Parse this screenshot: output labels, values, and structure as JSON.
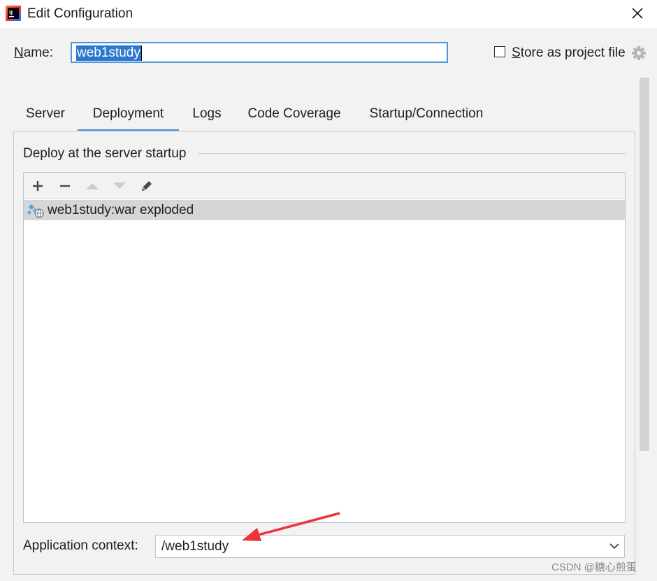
{
  "window": {
    "title": "Edit Configuration",
    "close_icon": "close-icon",
    "app_icon": "intellij-idea-icon"
  },
  "name_field": {
    "label_mnemonic": "N",
    "label_rest": "ame:",
    "value": "web1study"
  },
  "store_option": {
    "checked": false,
    "label_mnemonic": "S",
    "label_rest": "tore as project file",
    "icon": "gear-icon"
  },
  "tabs": [
    {
      "label": "Server",
      "active": false
    },
    {
      "label": "Deployment",
      "active": true
    },
    {
      "label": "Logs",
      "active": false
    },
    {
      "label": "Code Coverage",
      "active": false
    },
    {
      "label": "Startup/Connection",
      "active": false
    }
  ],
  "deployment": {
    "section_title": "Deploy at the server startup",
    "toolbar": [
      "add-icon",
      "remove-icon",
      "move-up-icon",
      "move-down-icon",
      "edit-icon"
    ],
    "artifacts": [
      {
        "label": "web1study:war exploded",
        "icon": "war-exploded-icon",
        "selected": true
      }
    ],
    "app_context_label": "Application context:",
    "app_context_value": "/web1study"
  },
  "watermark": "CSDN @糖心煎蛋",
  "colors": {
    "accent": "#3f8fda",
    "selection": "#2d78cf",
    "annotation_arrow": "#f0323c",
    "row_selected": "#d6d6d6"
  }
}
